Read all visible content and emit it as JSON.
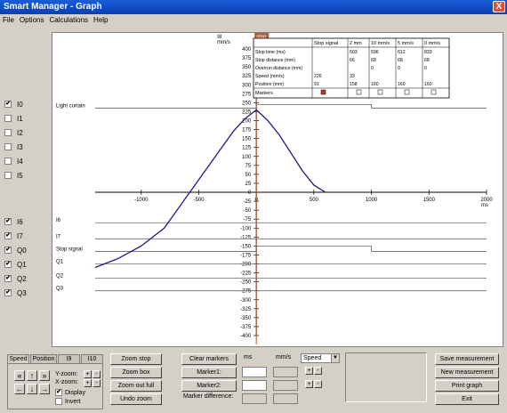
{
  "window": {
    "title": "Smart Manager - Graph",
    "close": "X"
  },
  "menu": [
    "File",
    "Options",
    "Calculations",
    "Help"
  ],
  "signals": [
    {
      "name": "I0",
      "checked": true
    },
    {
      "name": "I1",
      "checked": false
    },
    {
      "name": "I2",
      "checked": false
    },
    {
      "name": "I3",
      "checked": false
    },
    {
      "name": "I4",
      "checked": false
    },
    {
      "name": "I5",
      "checked": false
    },
    {
      "name": "I6",
      "checked": true
    },
    {
      "name": "I7",
      "checked": true
    },
    {
      "name": "Q0",
      "checked": true
    },
    {
      "name": "Q1",
      "checked": true
    },
    {
      "name": "Q2",
      "checked": true
    },
    {
      "name": "Q3",
      "checked": true
    }
  ],
  "chart_data": {
    "type": "line",
    "stop_label": "stop",
    "ylabel": "I8\nmm/s",
    "xlabel": "ms",
    "xlim": [
      -1400,
      2000
    ],
    "ylim": [
      -400,
      400
    ],
    "xticks": [
      -1000,
      -500,
      0,
      500,
      1000,
      1500,
      2000
    ],
    "yticks": [
      400,
      375,
      350,
      325,
      300,
      275,
      250,
      225,
      200,
      175,
      150,
      125,
      100,
      75,
      50,
      25,
      0,
      -25,
      -50,
      -75,
      -100,
      -125,
      -150,
      -175,
      -200,
      -225,
      -250,
      -275,
      -300,
      -325,
      -350,
      -375,
      -400
    ],
    "speed_curve": {
      "x": [
        -1400,
        -1200,
        -1000,
        -800,
        -600,
        -400,
        -200,
        -100,
        0,
        100,
        200,
        300,
        400,
        500,
        600
      ],
      "y": [
        -210,
        -185,
        -150,
        -100,
        -10,
        80,
        170,
        205,
        230,
        200,
        160,
        110,
        60,
        20,
        0
      ]
    },
    "traces": [
      {
        "name": "Light curtain",
        "y": 235,
        "step_y": 245,
        "step_x0": 0,
        "step_x1": 1000
      },
      {
        "name": "I6",
        "y": -85
      },
      {
        "name": "I7",
        "y": -130
      },
      {
        "name": "Stop signal",
        "y": -165,
        "step_y": -150,
        "step_x0": 0,
        "step_x1": 1000
      },
      {
        "name": "Q1",
        "y": -200
      },
      {
        "name": "Q2",
        "y": -240
      },
      {
        "name": "Q3",
        "y": -275
      }
    ]
  },
  "table": {
    "headers": [
      "",
      "Stop signal",
      "2 mm",
      "10 mm/s",
      "5 mm/s",
      "0 mm/s"
    ],
    "rows": [
      [
        "Stop time (ms)",
        "",
        "503",
        "596",
        "612",
        "833"
      ],
      [
        "Stop distance (mm)",
        "",
        "66",
        "68",
        "68",
        "68"
      ],
      [
        "Overrun distance (mm)",
        "",
        "",
        "0",
        "0",
        "0"
      ],
      [
        "Speed (mm/s)",
        "226",
        "33",
        "",
        "",
        ""
      ],
      [
        "Position (mm)",
        "91",
        "158",
        "160",
        "160",
        "160"
      ]
    ],
    "markers_label": "Markers"
  },
  "tabs": [
    "Speed",
    "Position",
    "I9",
    "I10"
  ],
  "zoom": {
    "y": "Y-zoom:",
    "x": "X-zoom:",
    "plus": "+",
    "minus": "-",
    "display": "Display",
    "invert": "Invert"
  },
  "buttons": {
    "zoom_stop": "Zoom stop",
    "zoom_box": "Zoom box",
    "zoom_out_full": "Zoom out full",
    "undo_zoom": "Undo zoom",
    "clear_markers": "Clear markers",
    "marker1": "Marker1:",
    "marker2": "Marker2:",
    "save": "Save measurement",
    "new": "New measurement",
    "print": "Print graph",
    "exit": "Exit"
  },
  "markers": {
    "ms": "ms",
    "mms": "mm/s",
    "difference": "Marker difference:",
    "select": "Speed",
    "select_arrow": "▼"
  },
  "arrows": {
    "ul": "«",
    "up": "↑",
    "ur": "»",
    "left": "←",
    "down": "↓",
    "right": "→"
  }
}
